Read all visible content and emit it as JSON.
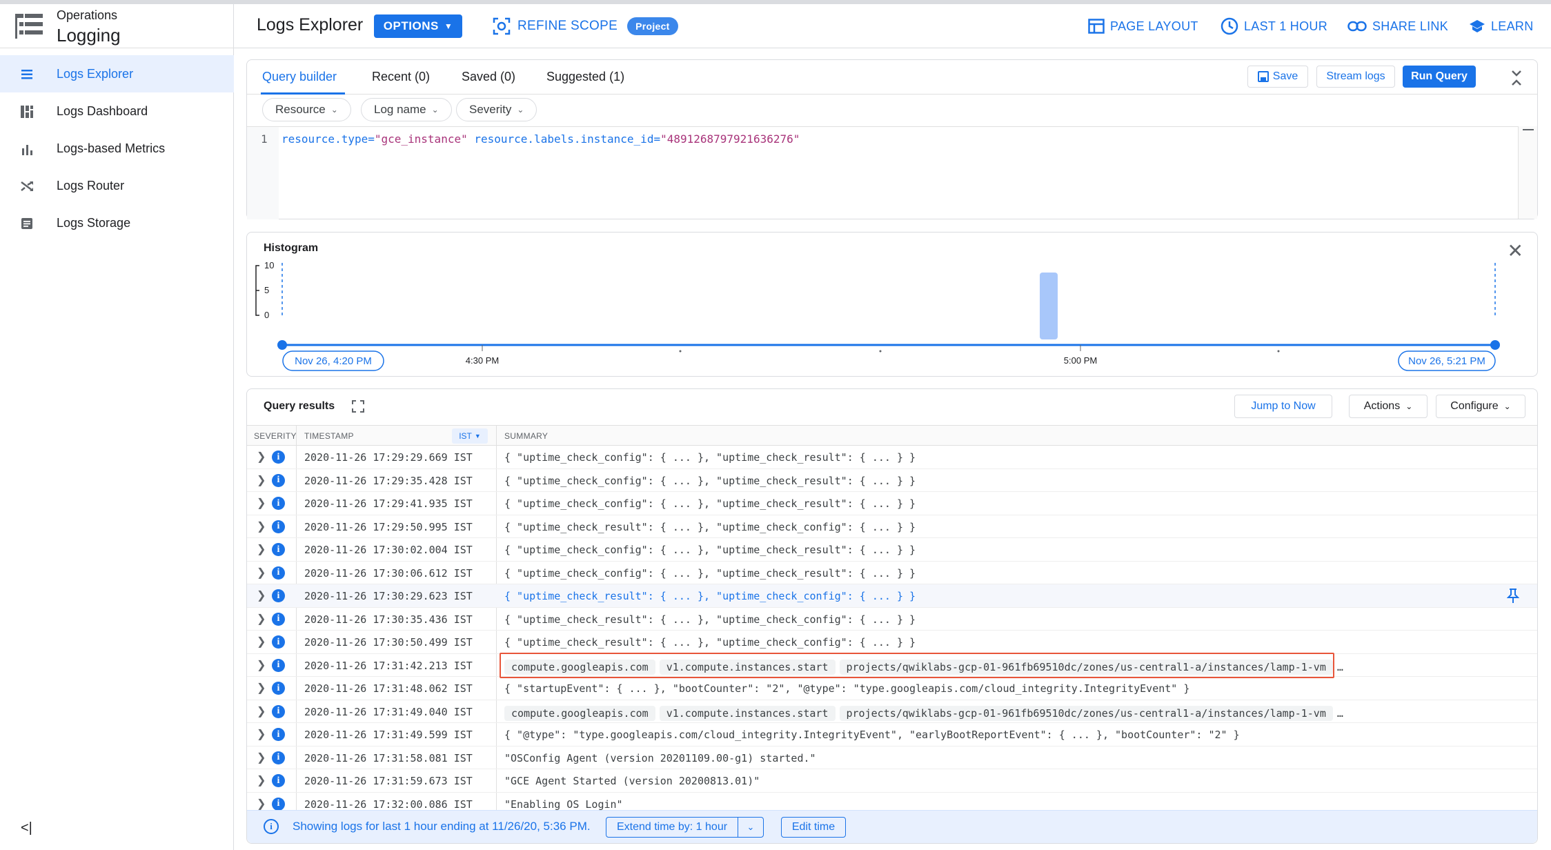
{
  "app": {
    "subtitle": "Operations",
    "title": "Logging"
  },
  "sidebar": {
    "items": [
      {
        "label": "Logs Explorer",
        "icon": "list-icon",
        "active": true
      },
      {
        "label": "Logs Dashboard",
        "icon": "dashboard-icon"
      },
      {
        "label": "Logs-based Metrics",
        "icon": "bar-chart-icon"
      },
      {
        "label": "Logs Router",
        "icon": "router-icon"
      },
      {
        "label": "Logs Storage",
        "icon": "storage-icon"
      }
    ],
    "collapse": "<|"
  },
  "header": {
    "title": "Logs Explorer",
    "options": "OPTIONS",
    "refine_scope": "REFINE SCOPE",
    "scope_badge": "Project",
    "page_layout": "PAGE LAYOUT",
    "time_range": "LAST 1 HOUR",
    "share_link": "SHARE LINK",
    "learn": "LEARN"
  },
  "query_builder": {
    "tabs": [
      "Query builder",
      "Recent (0)",
      "Saved (0)",
      "Suggested (1)"
    ],
    "save": "Save",
    "stream_logs": "Stream logs",
    "run_query": "Run Query",
    "filters": [
      "Resource",
      "Log name",
      "Severity"
    ],
    "line_number": "1",
    "query_part1_key": "resource.type=",
    "query_part1_val": "\"gce_instance\"",
    "query_part2_key": "resource.labels.instance_id=",
    "query_part2_val": "\"4891268797921636276\""
  },
  "histogram": {
    "title": "Histogram",
    "y_ticks": [
      "10",
      "5",
      "0"
    ],
    "x_ticks": [
      "4:30 PM",
      "5:00 PM"
    ],
    "start_label": "Nov 26, 4:20 PM",
    "end_label": "Nov 26, 5:21 PM"
  },
  "results": {
    "title": "Query results",
    "jump_to_now": "Jump to Now",
    "actions": "Actions",
    "configure": "Configure",
    "columns": {
      "severity": "SEVERITY",
      "timestamp": "TIMESTAMP",
      "tz": "IST",
      "summary": "SUMMARY"
    },
    "rows": [
      {
        "ts": "2020-11-26 17:29:29.669 IST",
        "summary": "{ \"uptime_check_config\": { ... }, \"uptime_check_result\": { ... } }"
      },
      {
        "ts": "2020-11-26 17:29:35.428 IST",
        "summary": "{ \"uptime_check_config\": { ... }, \"uptime_check_result\": { ... } }"
      },
      {
        "ts": "2020-11-26 17:29:41.935 IST",
        "summary": "{ \"uptime_check_config\": { ... }, \"uptime_check_result\": { ... } }"
      },
      {
        "ts": "2020-11-26 17:29:50.995 IST",
        "summary": "{ \"uptime_check_result\": { ... }, \"uptime_check_config\": { ... } }"
      },
      {
        "ts": "2020-11-26 17:30:02.004 IST",
        "summary": "{ \"uptime_check_config\": { ... }, \"uptime_check_result\": { ... } }"
      },
      {
        "ts": "2020-11-26 17:30:06.612 IST",
        "summary": "{ \"uptime_check_config\": { ... }, \"uptime_check_result\": { ... } }"
      },
      {
        "ts": "2020-11-26 17:30:29.623 IST",
        "summary": "{ \"uptime_check_result\": { ... }, \"uptime_check_config\": { ... } }"
      },
      {
        "ts": "2020-11-26 17:30:35.436 IST",
        "summary": "{ \"uptime_check_result\": { ... }, \"uptime_check_config\": { ... } }"
      },
      {
        "ts": "2020-11-26 17:30:50.499 IST",
        "summary": "{ \"uptime_check_result\": { ... }, \"uptime_check_config\": { ... } }"
      },
      {
        "ts": "2020-11-26 17:31:42.213 IST",
        "pills": [
          "compute.googleapis.com",
          "v1.compute.instances.start",
          "projects/qwiklabs-gcp-01-961fb69510dc/zones/us-central1-a/instances/lamp-1-vm"
        ],
        "more": "…"
      },
      {
        "ts": "2020-11-26 17:31:48.062 IST",
        "summary": "{ \"startupEvent\": { ... }, \"bootCounter\": \"2\", \"@type\": \"type.googleapis.com/cloud_integrity.IntegrityEvent\" }"
      },
      {
        "ts": "2020-11-26 17:31:49.040 IST",
        "pills": [
          "compute.googleapis.com",
          "v1.compute.instances.start",
          "projects/qwiklabs-gcp-01-961fb69510dc/zones/us-central1-a/instances/lamp-1-vm"
        ],
        "more": "…"
      },
      {
        "ts": "2020-11-26 17:31:49.599 IST",
        "summary": "{ \"@type\": \"type.googleapis.com/cloud_integrity.IntegrityEvent\", \"earlyBootReportEvent\": { ... }, \"bootCounter\": \"2\" }"
      },
      {
        "ts": "2020-11-26 17:31:58.081 IST",
        "summary": "\"OSConfig Agent (version 20201109.00-g1) started.\""
      },
      {
        "ts": "2020-11-26 17:31:59.673 IST",
        "summary": "\"GCE Agent Started (version 20200813.01)\""
      },
      {
        "ts": "2020-11-26 17:32:00.086 IST",
        "summary": "\"Enabling OS Login\""
      }
    ],
    "footer_text": "Showing logs for last 1 hour ending at 11/26/20, 5:36 PM.",
    "extend_time": "Extend time by: 1 hour",
    "edit_time": "Edit time"
  },
  "colors": {
    "accent": "#1a73e8",
    "highlight_box": "#e8553a"
  }
}
